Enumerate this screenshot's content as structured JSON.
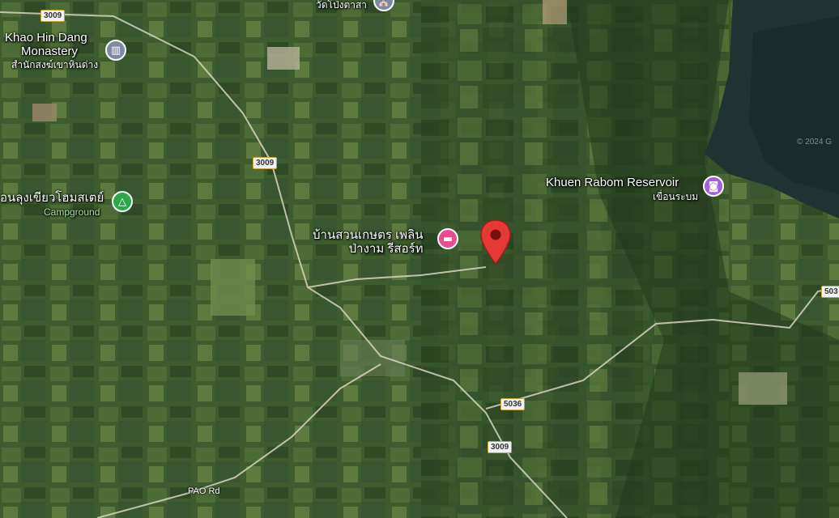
{
  "places": {
    "khao_hin_dang_en_1": "Khao Hin Dang",
    "khao_hin_dang_en_2": "Monastery",
    "khao_hin_dang_th": "สำนักสงฆ์เขาหินด่าง",
    "camp_th": "อนลุงเขียวโฮมสเตย์",
    "camp_sub": "Campground",
    "resort_th_1": "บ้านสวนเกษตร เพลิน",
    "resort_th_2": "ป่างาม รีสอร์ท",
    "reservoir_en": "Khuen Rabom Reservoir",
    "reservoir_th": "เขื่อนระบม",
    "temple_top_th": "วัดโป่งตาสา"
  },
  "roads": {
    "r3009_a": "3009",
    "r3009_b": "3009",
    "r3009_c": "3009",
    "r5036": "5036",
    "r503_edge": "503",
    "pao_rd": "PAO Rd"
  },
  "copyright": "© 2024 G",
  "icons": {
    "monastery": "religious-site-icon",
    "camp": "campground-icon",
    "hotel": "hotel-bed-icon",
    "reservoir": "camera-attraction-icon",
    "pin": "location-pin-icon"
  },
  "colors": {
    "pin": "#e53935",
    "hotel_poi": "#e94d8f",
    "attraction_poi": "#a15ee0",
    "camp_poi": "#2aa84a",
    "religious_poi": "#7e8aa0"
  }
}
